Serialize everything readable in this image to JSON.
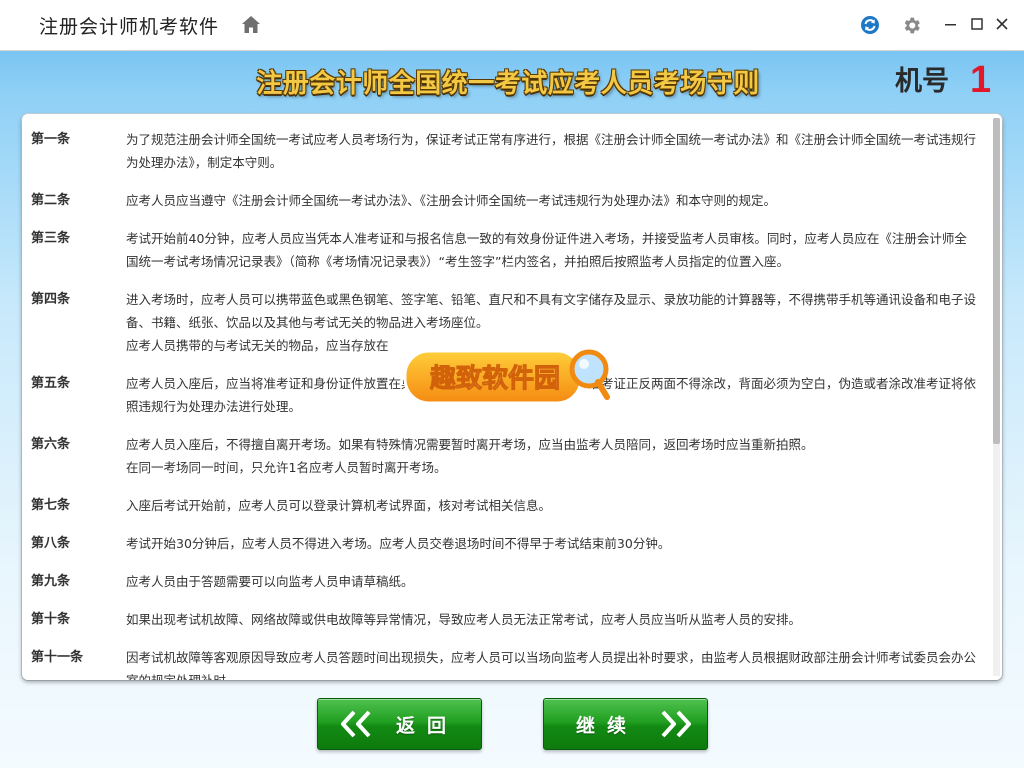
{
  "app": {
    "title": "注册会计师机考软件"
  },
  "header": {
    "rules_title": "注册会计师全国统一考试应考人员考场守则",
    "machine_label": "机号",
    "machine_number": "1"
  },
  "articles": [
    {
      "no": "第一条",
      "paragraphs": [
        "为了规范注册会计师全国统一考试应考人员考场行为，保证考试正常有序进行，根据《注册会计师全国统一考试办法》和《注册会计师全国统一考试违规行为处理办法》，制定本守则。"
      ]
    },
    {
      "no": "第二条",
      "paragraphs": [
        "应考人员应当遵守《注册会计师全国统一考试办法》、《注册会计师全国统一考试违规行为处理办法》和本守则的规定。"
      ]
    },
    {
      "no": "第三条",
      "paragraphs": [
        "考试开始前40分钟，应考人员应当凭本人准考证和与报名信息一致的有效身份证件进入考场，并接受监考人员审核。同时，应考人员应在《注册会计师全国统一考试考场情况记录表》（简称《考场情况记录表》）“考生签字”栏内签名，并拍照后按照监考人员指定的位置入座。"
      ]
    },
    {
      "no": "第四条",
      "paragraphs": [
        "进入考场时，应考人员可以携带蓝色或黑色钢笔、签字笔、铅笔、直尺和不具有文字储存及显示、录放功能的计算器等，不得携带手机等通讯设备和电子设备、书籍、纸张、饮品以及其他与考试无关的物品进入考场座位。",
        "应考人员携带的与考试无关的物品，应当存放在"
      ]
    },
    {
      "no": "第五条",
      "paragraphs": [
        "应考人员入座后，应当将准考证和身份证件放置在桌面右上角，以便监考人员查验。准考证正反两面不得涂改，背面必须为空白，伪造或者涂改准考证将依照违规行为处理办法进行处理。"
      ]
    },
    {
      "no": "第六条",
      "paragraphs": [
        "应考人员入座后，不得擅自离开考场。如果有特殊情况需要暂时离开考场，应当由监考人员陪同，返回考场时应当重新拍照。",
        "在同一考场同一时间，只允许1名应考人员暂时离开考场。"
      ]
    },
    {
      "no": "第七条",
      "paragraphs": [
        "入座后考试开始前，应考人员可以登录计算机考试界面，核对考试相关信息。"
      ]
    },
    {
      "no": "第八条",
      "paragraphs": [
        "考试开始30分钟后，应考人员不得进入考场。应考人员交卷退场时间不得早于考试结束前30分钟。"
      ]
    },
    {
      "no": "第九条",
      "paragraphs": [
        "应考人员由于答题需要可以向监考人员申请草稿纸。"
      ]
    },
    {
      "no": "第十条",
      "paragraphs": [
        "如果出现考试机故障、网络故障或供电故障等异常情况，导致应考人员无法正常考试，应考人员应当听从监考人员的安排。"
      ]
    },
    {
      "no": "第十一条",
      "paragraphs": [
        "因考试机故障等客观原因导致应考人员答题时间出现损失，应考人员可以当场向监考人员提出补时要求，由监考人员根据财政部注册会计师考试委员会办公室的规定处理补时。"
      ]
    }
  ],
  "watermark": {
    "text": "趣致软件园"
  },
  "buttons": {
    "back_label": "返回",
    "next_label": "继续"
  },
  "colors": {
    "title_gold": "#f3c845",
    "machine_number_red": "#e0182a",
    "button_green": "#21a021"
  }
}
